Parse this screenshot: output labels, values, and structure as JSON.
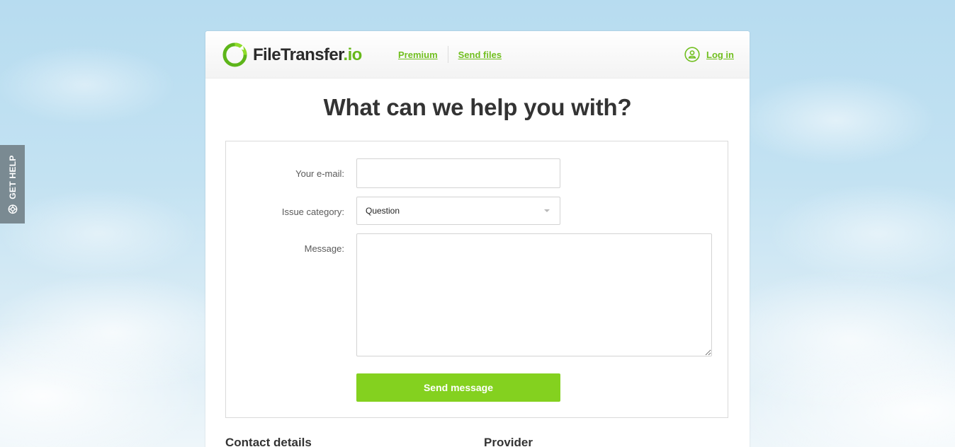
{
  "sidebar_tab": {
    "label": "GET HELP",
    "icon": "lifebuoy-icon"
  },
  "header": {
    "logo": {
      "name": "FileTransfer",
      "tld": ".io",
      "icon": "logo-ring-icon"
    },
    "nav": [
      {
        "label": "Premium"
      },
      {
        "label": "Send files"
      }
    ],
    "login": {
      "label": "Log in",
      "icon": "user-icon"
    }
  },
  "main": {
    "title": "What can we help you with?",
    "form": {
      "email_label": "Your e-mail:",
      "email_value": "",
      "category_label": "Issue category:",
      "category_value": "Question",
      "message_label": "Message:",
      "message_value": "",
      "submit_label": "Send message"
    },
    "sections": [
      {
        "heading": "Contact details"
      },
      {
        "heading": "Provider"
      }
    ]
  },
  "colors": {
    "brand_green": "#84d11f",
    "link_green": "#71bf1f",
    "text_dark": "#333333",
    "tab_gray": "#7a8a92"
  }
}
